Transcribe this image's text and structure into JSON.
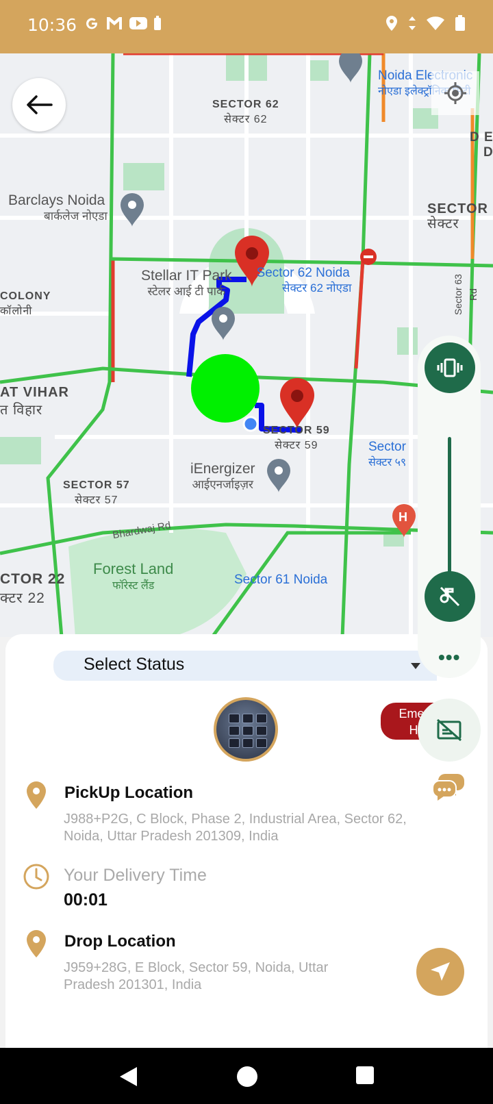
{
  "status_bar": {
    "time": "10:36"
  },
  "map": {
    "labels": {
      "sector62": "SECTOR 62",
      "sector62_hi": "सेक्टर 62",
      "barclays": "Barclays Noida",
      "barclays_hi": "बार्कलेज नोएडा",
      "stellar": "Stellar IT Park",
      "stellar_hi": "स्टेलर आई टी पार्क",
      "sector62noida": "Sector 62 Noida",
      "sector62noida_hi": "सेक्टर 62 नोएडा",
      "colony": "COLONY",
      "colony_hi": "कॉलोनी",
      "vihar": "AT VIHAR",
      "vihar_hi": "त विहार",
      "sector59": "SECTOR 59",
      "sector59_hi": "सेक्टर 59",
      "sector_right": "Sector",
      "sector_right_hi": "सेक्टर ५९",
      "ienergizer": "iEnergizer",
      "ienergizer_hi": "आईएनर्जाइज़र",
      "sector57": "SECTOR 57",
      "sector57_hi": "सेक्टर 57",
      "bhardwaj": "Bhardwaj Rd",
      "forest": "Forest Land",
      "forest_hi": "फॉरेस्ट लैंड",
      "sector61noida": "Sector 61 Noida",
      "sector22": "CTOR 22",
      "sector22_hi": "क्टर 22",
      "noida_electronic": "Noida Electronic",
      "noida_electronic_hi": "नोएडा इलेक्ट्रॉनिक सिटी",
      "sector_top_right": "SECTOR",
      "sector_top_right_hi": "सेक्टर",
      "de": "D E",
      "de2": "D",
      "sector63rd": "Sector 63 Rd"
    }
  },
  "status_select": {
    "label": "Select Status"
  },
  "emergency": {
    "label": "Emer\nH"
  },
  "pickup": {
    "title": "PickUp Location",
    "address": "J988+P2G, C Block, Phase 2, Industrial Area, Sector 62, Noida, Uttar Pradesh 201309, India"
  },
  "delivery": {
    "label": "Your Delivery Time",
    "value": "00:01"
  },
  "drop": {
    "title": "Drop Location",
    "address": "J959+28G, E Block, Sector 59, Noida, Uttar Pradesh 201301, India"
  },
  "side_panel": {
    "dots": "•••"
  },
  "colors": {
    "accent": "#d4a55d",
    "side_green": "#1f6b4a",
    "route": "#0a12e8",
    "marker_green": "#00f000",
    "pin_red": "#d93025"
  }
}
